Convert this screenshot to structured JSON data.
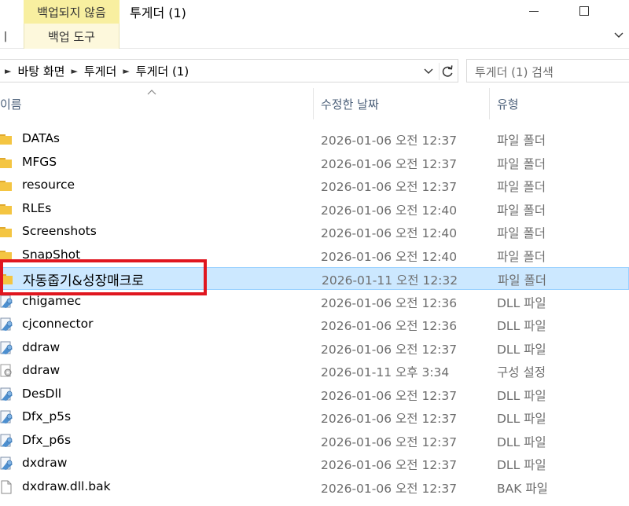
{
  "window": {
    "contextual_tab": "백업되지 않음",
    "title": "투게더 (1)"
  },
  "ribbon": {
    "left_cut": "ㅣ",
    "contextual_tool": "백업 도구"
  },
  "address": {
    "crumbs": [
      "바탕 화면",
      "투게더",
      "투게더 (1)"
    ]
  },
  "search": {
    "placeholder": "투게더 (1) 검색"
  },
  "columns": {
    "name": "이름",
    "date": "수정한 날짜",
    "type": "유형"
  },
  "colors": {
    "folder": "#f4c542",
    "selection": "#cce8ff",
    "highlight": "#e0161f"
  },
  "files": [
    {
      "name": "DATAs",
      "date": "2026-01-06 오전 12:37",
      "type": "파일 폴더",
      "icon": "folder-icon"
    },
    {
      "name": "MFGS",
      "date": "2026-01-06 오전 12:37",
      "type": "파일 폴더",
      "icon": "folder-icon"
    },
    {
      "name": "resource",
      "date": "2026-01-06 오전 12:37",
      "type": "파일 폴더",
      "icon": "folder-icon"
    },
    {
      "name": "RLEs",
      "date": "2026-01-06 오전 12:40",
      "type": "파일 폴더",
      "icon": "folder-icon"
    },
    {
      "name": "Screenshots",
      "date": "2026-01-06 오전 12:40",
      "type": "파일 폴더",
      "icon": "folder-icon"
    },
    {
      "name": "SnapShot",
      "date": "2026-01-06 오전 12:40",
      "type": "파일 폴더",
      "icon": "folder-icon"
    },
    {
      "name": "자동줍기&성장매크로",
      "date": "2026-01-11 오전 12:32",
      "type": "파일 폴더",
      "icon": "folder-icon",
      "selected": true
    },
    {
      "name": "chigamec",
      "date": "2026-01-06 오전 12:36",
      "type": "DLL 파일",
      "icon": "dll-icon"
    },
    {
      "name": "cjconnector",
      "date": "2026-01-06 오전 12:36",
      "type": "DLL 파일",
      "icon": "dll-icon"
    },
    {
      "name": "ddraw",
      "date": "2026-01-06 오전 12:37",
      "type": "DLL 파일",
      "icon": "dll-icon"
    },
    {
      "name": "ddraw",
      "date": "2026-01-11 오후 3:34",
      "type": "구성 설정",
      "icon": "config-icon"
    },
    {
      "name": "DesDll",
      "date": "2026-01-06 오전 12:37",
      "type": "DLL 파일",
      "icon": "dll-icon"
    },
    {
      "name": "Dfx_p5s",
      "date": "2026-01-06 오전 12:37",
      "type": "DLL 파일",
      "icon": "dll-icon"
    },
    {
      "name": "Dfx_p6s",
      "date": "2026-01-06 오전 12:37",
      "type": "DLL 파일",
      "icon": "dll-icon"
    },
    {
      "name": "dxdraw",
      "date": "2026-01-06 오전 12:37",
      "type": "DLL 파일",
      "icon": "dll-icon"
    },
    {
      "name": "dxdraw.dll.bak",
      "date": "2026-01-06 오전 12:37",
      "type": "BAK 파일",
      "icon": "file-icon"
    }
  ]
}
